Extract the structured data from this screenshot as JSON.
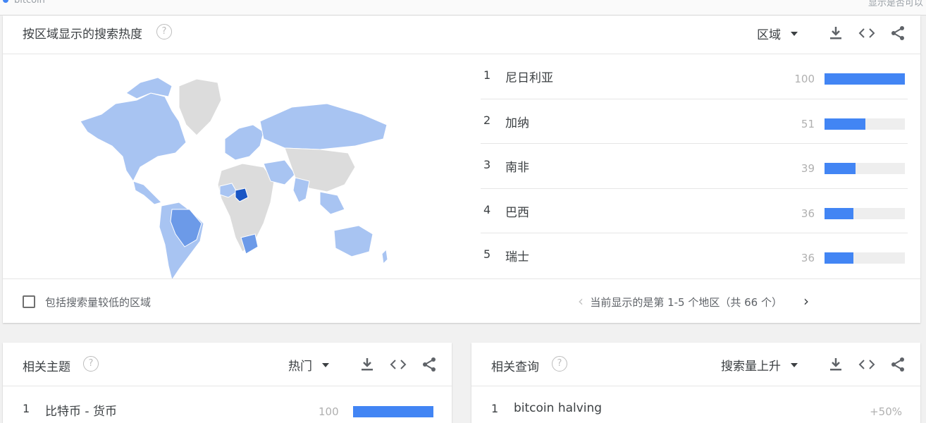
{
  "top": {
    "left_text": "bitcoin",
    "right_text": "显示是否可以"
  },
  "region_card": {
    "title": "按区域显示的搜索热度",
    "help": "?",
    "dropdown_label": "区域",
    "regions": [
      {
        "rank": "1",
        "name": "尼日利亚",
        "value": "100",
        "fraction": 1.0
      },
      {
        "rank": "2",
        "name": "加纳",
        "value": "51",
        "fraction": 0.51
      },
      {
        "rank": "3",
        "name": "南非",
        "value": "39",
        "fraction": 0.39
      },
      {
        "rank": "4",
        "name": "巴西",
        "value": "36",
        "fraction": 0.36
      },
      {
        "rank": "5",
        "name": "瑞士",
        "value": "36",
        "fraction": 0.36
      }
    ],
    "checkbox_label": "包括搜索量较低的区域",
    "pager_text": "当前显示的是第 1-5 个地区（共 66 个）",
    "pager_prev": "‹",
    "pager_next": "›"
  },
  "topics_card": {
    "title": "相关主题",
    "help": "?",
    "dropdown_label": "热门",
    "rows": [
      {
        "rank": "1",
        "name": "比特币 - 货币",
        "value": "100"
      }
    ]
  },
  "queries_card": {
    "title": "相关查询",
    "help": "?",
    "dropdown_label": "搜索量上升",
    "rows": [
      {
        "rank": "1",
        "name": "bitcoin halving",
        "value": "+50%"
      }
    ]
  },
  "colors": {
    "accent": "#4285f4",
    "map_strong": "#1a56c4",
    "map_medium": "#6c9ae8",
    "map_light": "#a8c4f2",
    "map_none": "#dcdcdc"
  }
}
